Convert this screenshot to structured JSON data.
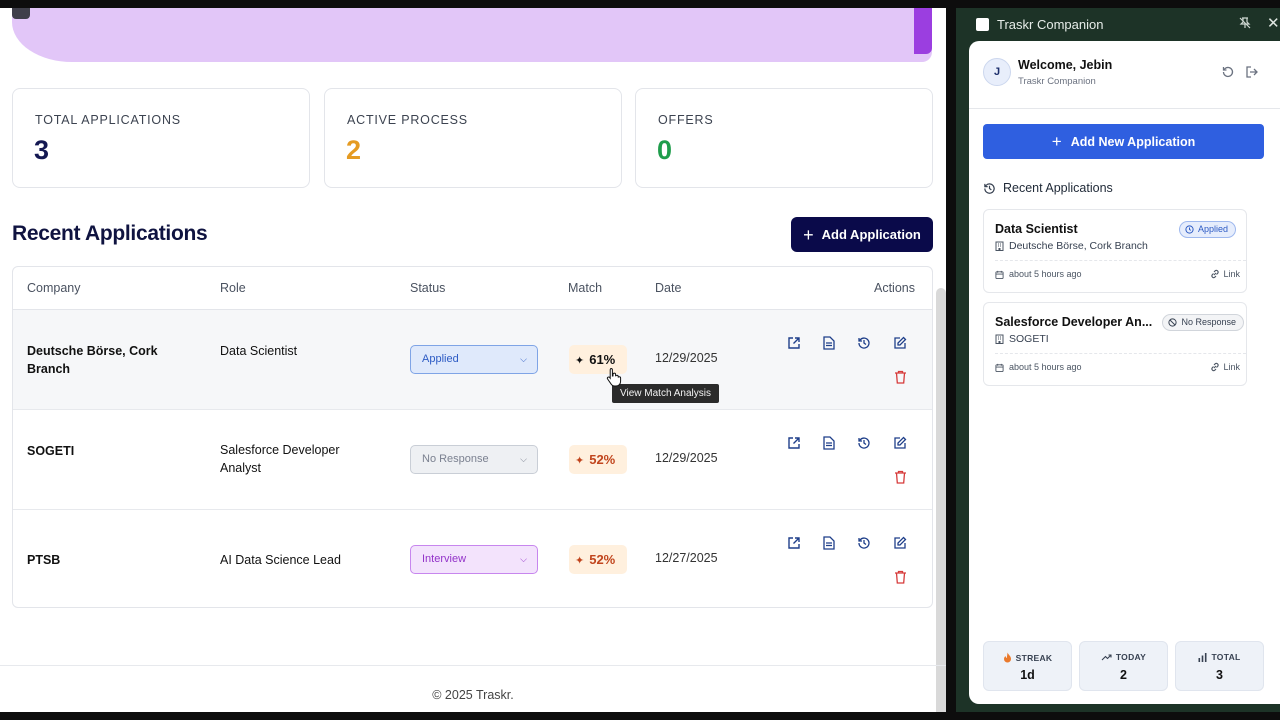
{
  "stats": [
    {
      "label": "TOTAL APPLICATIONS",
      "value": "3",
      "color": "#141852"
    },
    {
      "label": "ACTIVE PROCESS",
      "value": "2",
      "color": "#e59b22"
    },
    {
      "label": "OFFERS",
      "value": "0",
      "color": "#1f9d4c"
    }
  ],
  "section": {
    "title": "Recent Applications",
    "add_label": "Add Application"
  },
  "table": {
    "headers": {
      "company": "Company",
      "role": "Role",
      "status": "Status",
      "match": "Match",
      "date": "Date",
      "actions": "Actions"
    },
    "rows": [
      {
        "company": "Deutsche Börse, Cork Branch",
        "role": "Data Scientist",
        "status": "Applied",
        "match": "61%",
        "date": "12/29/2025"
      },
      {
        "company": "SOGETI",
        "role": "Salesforce Developer Analyst",
        "status": "No Response",
        "match": "52%",
        "date": "12/29/2025"
      },
      {
        "company": "PTSB",
        "role": "AI Data Science Lead",
        "status": "Interview",
        "match": "52%",
        "date": "12/27/2025"
      }
    ]
  },
  "tooltip": "View Match Analysis",
  "footer": "© 2025 Traskr.",
  "panel": {
    "title": "Traskr Companion",
    "welcome": "Welcome, Jebin",
    "subtitle": "Traskr Companion",
    "avatar": "J",
    "add_new": "Add New Application",
    "recent_title": "Recent Applications",
    "cards": [
      {
        "title": "Data Scientist",
        "company": "Deutsche Börse, Cork Branch",
        "badge": "Applied",
        "time": "about 5 hours ago",
        "link": "Link"
      },
      {
        "title": "Salesforce Developer An...",
        "company": "SOGETI",
        "badge": "No Response",
        "time": "about 5 hours ago",
        "link": "Link"
      }
    ],
    "stats": [
      {
        "label": "STREAK",
        "value": "1d"
      },
      {
        "label": "TODAY",
        "value": "2"
      },
      {
        "label": "TOTAL",
        "value": "3"
      }
    ]
  },
  "colors": {
    "applied_bg": "#dfe9fb",
    "applied_border": "#7fa4e6",
    "applied_text": "#2d5bc4",
    "noresp_bg": "#eef0f3",
    "noresp_border": "#c9ced6",
    "noresp_text": "#7b8190",
    "interview_bg": "#f3e3fc",
    "interview_border": "#c786ee",
    "interview_text": "#9333c9",
    "match_high": "#111111",
    "match_mid": "#c1451d",
    "action_icon": "#1f3f8a",
    "delete_icon": "#d63a3a"
  }
}
